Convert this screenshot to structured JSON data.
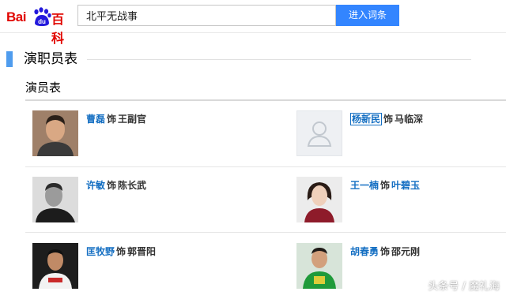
{
  "header": {
    "logo_bai": "Bai",
    "logo_du": "du",
    "logo_baike": "百科",
    "search_value": "北平无战事",
    "search_button": "进入词条"
  },
  "section": {
    "title": "演职员表",
    "subtitle": "演员表"
  },
  "cast": [
    {
      "actor": "曹磊",
      "as": "饰",
      "role": "王副官",
      "role_link": false,
      "selected": false,
      "photo": "man-portrait"
    },
    {
      "actor": "杨新民",
      "as": "饰",
      "role": "马临深",
      "role_link": false,
      "selected": true,
      "photo": "person-placeholder"
    },
    {
      "actor": "许敏",
      "as": "饰",
      "role": "陈长武",
      "role_link": false,
      "selected": false,
      "photo": "man-portrait-bw"
    },
    {
      "actor": "王一楠",
      "as": "饰",
      "role": "叶碧玉",
      "role_link": true,
      "selected": false,
      "photo": "woman-portrait"
    },
    {
      "actor": "匡牧野",
      "as": "饰",
      "role": "郭晋阳",
      "role_link": false,
      "selected": false,
      "photo": "man-portrait"
    },
    {
      "actor": "胡春勇",
      "as": "饰",
      "role": "邵元刚",
      "role_link": false,
      "selected": false,
      "photo": "man-portrait-green"
    }
  ],
  "watermark": "头条号 / 魔礼海",
  "colors": {
    "accent": "#3385ff",
    "link": "#136ec2",
    "brand_red": "#e10601",
    "section_bar": "#4f9cee"
  }
}
